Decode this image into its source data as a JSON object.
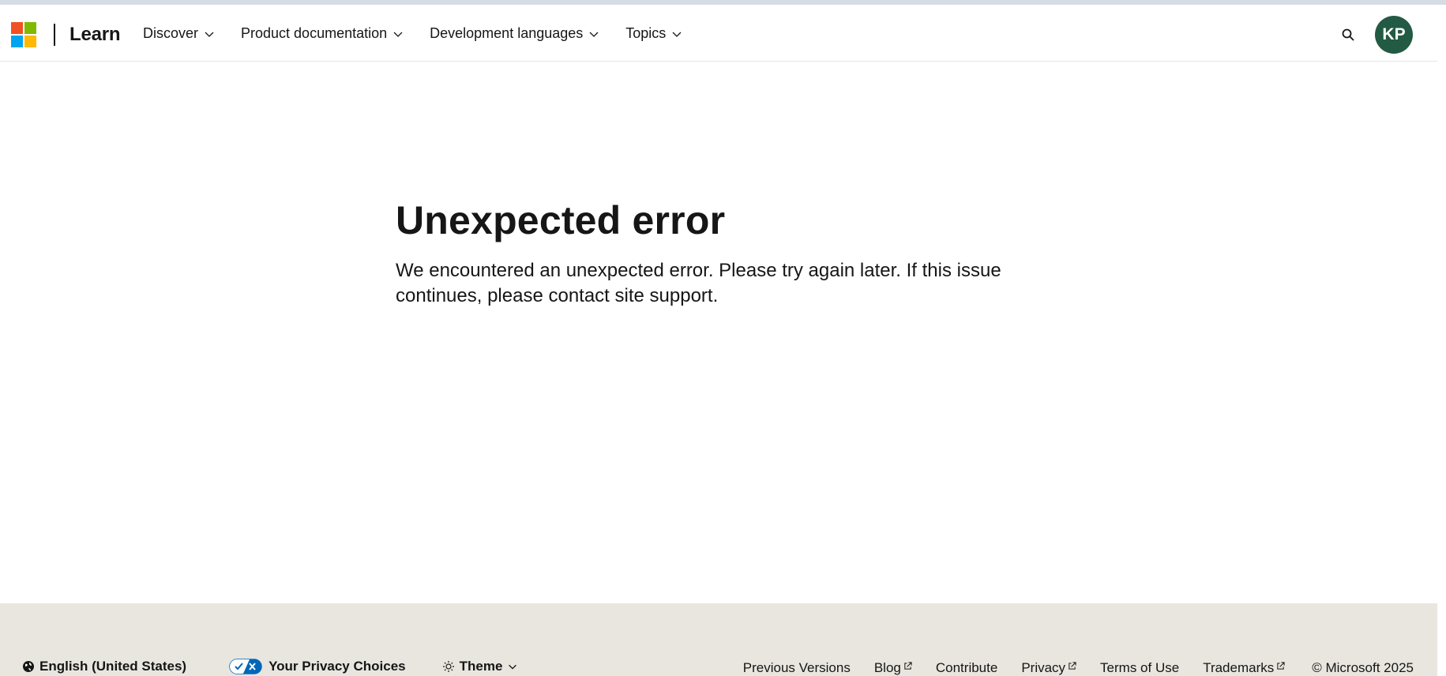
{
  "header": {
    "brand": "Learn",
    "nav": [
      {
        "label": "Discover"
      },
      {
        "label": "Product documentation"
      },
      {
        "label": "Development languages"
      },
      {
        "label": "Topics"
      }
    ],
    "avatar_initials": "KP",
    "avatar_color": "#235a44"
  },
  "main": {
    "title": "Unexpected error",
    "message": "We encountered an unexpected error. Please try again later. If this issue continues, please contact site support."
  },
  "footer": {
    "language": "English (United States)",
    "privacy_choices": "Your Privacy Choices",
    "theme": "Theme",
    "links": [
      {
        "label": "Previous Versions",
        "external": false
      },
      {
        "label": "Blog",
        "external": true
      },
      {
        "label": "Contribute",
        "external": false
      },
      {
        "label": "Privacy",
        "external": true
      },
      {
        "label": "Terms of Use",
        "external": false
      },
      {
        "label": "Trademarks",
        "external": true
      }
    ],
    "copyright": "© Microsoft 2025"
  }
}
